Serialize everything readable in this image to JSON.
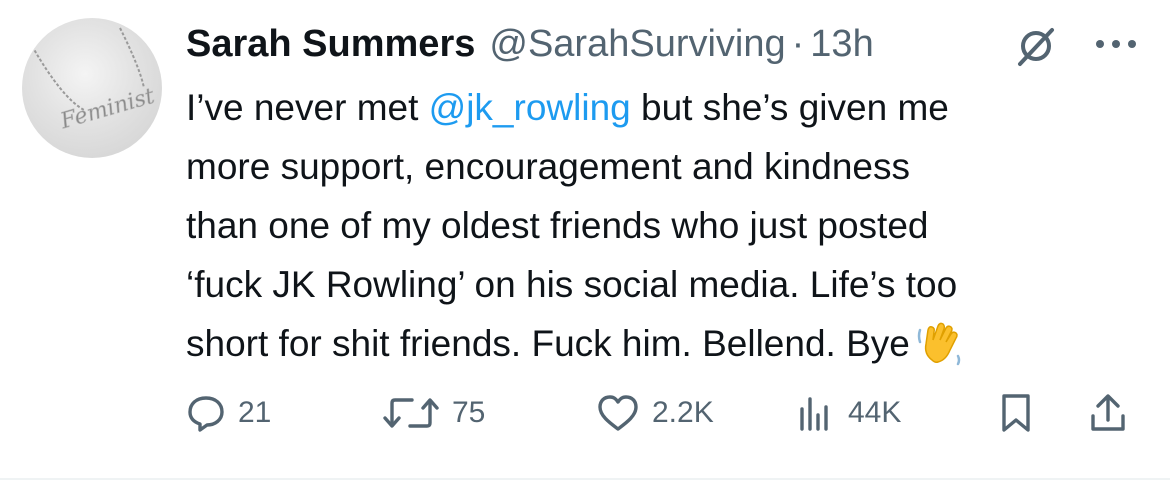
{
  "author": {
    "name": "Sarah Summers",
    "handle": "@SarahSurviving",
    "separator": "·",
    "time": "13h"
  },
  "avatar": {
    "text": "Feminist"
  },
  "tweet": {
    "line1_pre": "I’ve never met ",
    "mention": "@jk_rowling",
    "line1_post": " but she’s given me",
    "line2": "more support, encouragement and kindness",
    "line3": "than one of my oldest friends who just posted",
    "line4": "‘fuck JK Rowling’ on his social media. Life’s too",
    "line5": "short for shit friends. Fuck him. Bellend. Bye"
  },
  "actions": {
    "replies": "21",
    "reposts": "75",
    "likes": "2.2K",
    "views": "44K"
  },
  "icons": [
    "grok-icon",
    "more-icon",
    "reply-icon",
    "repost-icon",
    "like-icon",
    "views-icon",
    "bookmark-icon",
    "share-icon",
    "waving-hand-emoji"
  ],
  "colors": {
    "text": "#0f1419",
    "secondary": "#536471",
    "link": "#1d9bf0"
  }
}
